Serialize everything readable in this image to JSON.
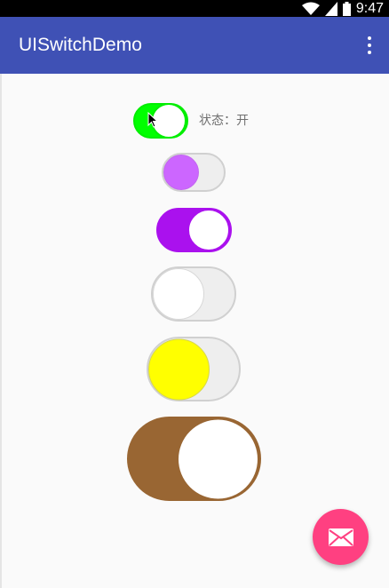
{
  "statusbar": {
    "time": "9:47",
    "icons": [
      "wifi-icon",
      "signal-icon",
      "battery-icon"
    ]
  },
  "appbar": {
    "title": "UISwitchDemo",
    "menu_icon": "overflow-menu-icon",
    "color": "#3f51b5"
  },
  "status_label": "状态：开",
  "switches": [
    {
      "name": "switch-green",
      "state": "on",
      "track_color": "#00ff00",
      "knob_color": "#ffffff"
    },
    {
      "name": "switch-violet-small",
      "state": "off",
      "track_color": "#eeeeee",
      "knob_color": "#cc66ff"
    },
    {
      "name": "switch-purple",
      "state": "on",
      "track_color": "#aa11ee",
      "knob_color": "#ffffff"
    },
    {
      "name": "switch-white",
      "state": "off",
      "track_color": "#eeeeee",
      "knob_color": "#ffffff"
    },
    {
      "name": "switch-yellow",
      "state": "off",
      "track_color": "#eeeeee",
      "knob_color": "#ffff00"
    },
    {
      "name": "switch-brown-large",
      "state": "on",
      "track_color": "#996633",
      "knob_color": "#ffffff"
    }
  ],
  "fab": {
    "icon": "mail-icon",
    "color": "#ff4081"
  }
}
